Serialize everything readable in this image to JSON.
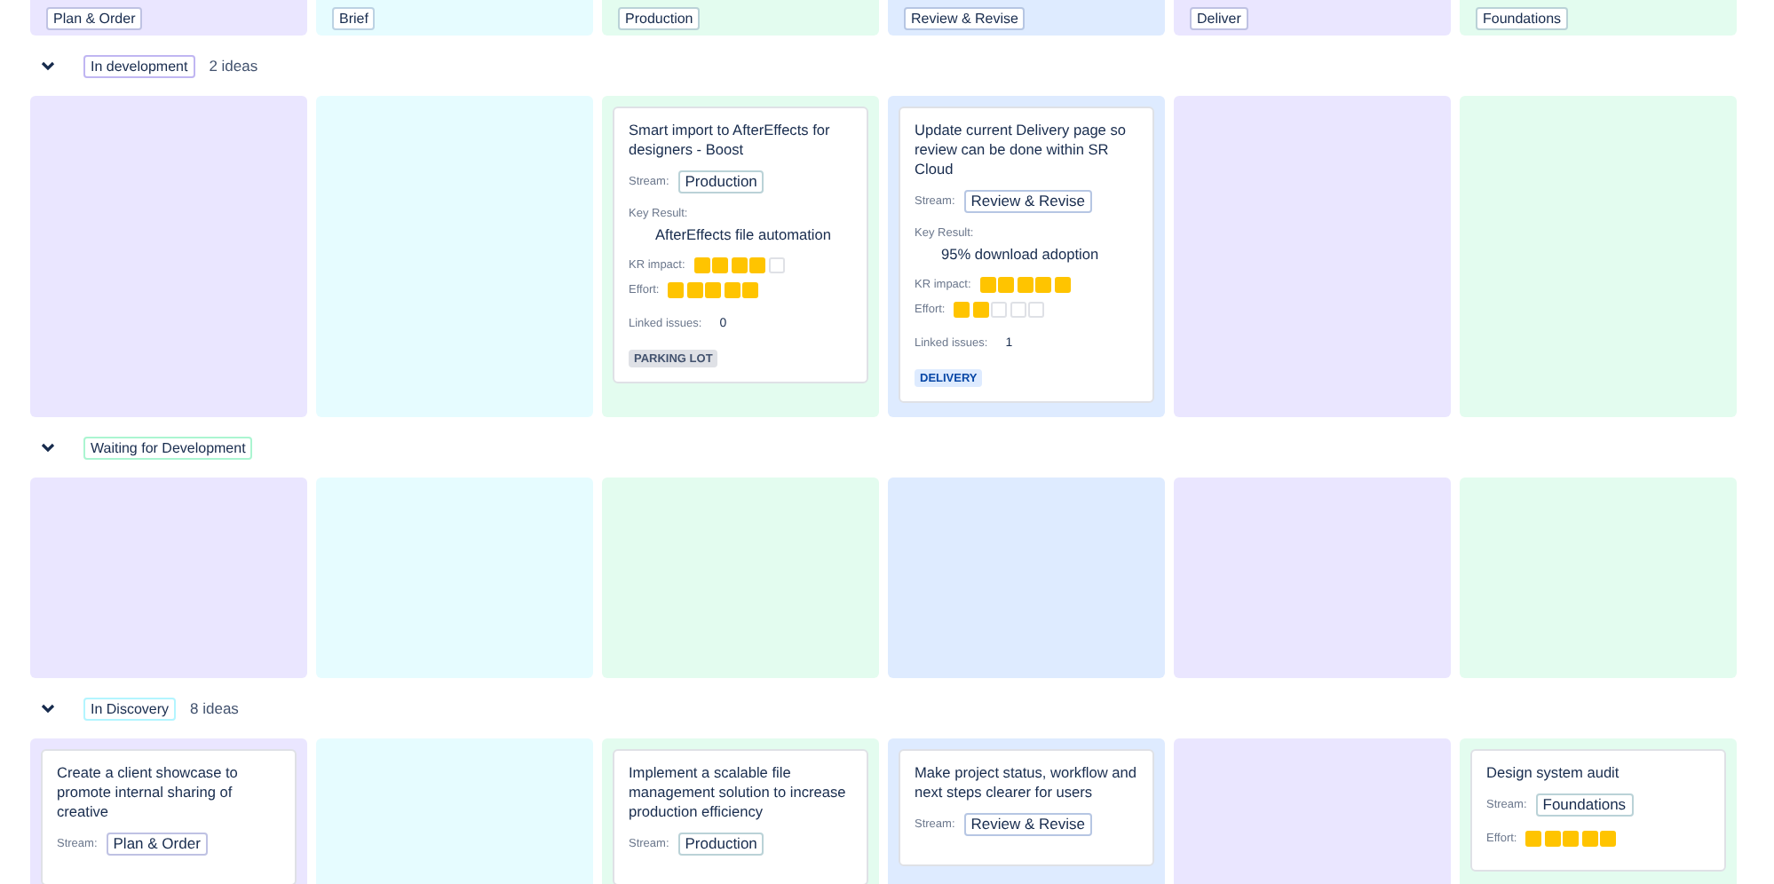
{
  "columns": [
    {
      "label": "Plan & Order",
      "color": "#eae6ff"
    },
    {
      "label": "Brief",
      "color": "#e6fcff"
    },
    {
      "label": "Production",
      "color": "#e3fcef"
    },
    {
      "label": "Review & Revise",
      "color": "#deebff"
    },
    {
      "label": "Deliver",
      "color": "#eae6ff"
    },
    {
      "label": "Foundations",
      "color": "#e3fcef"
    }
  ],
  "sections": [
    {
      "label": "In development",
      "count": "2 ideas",
      "expanded": true,
      "color": "#c0b6f2",
      "cells": [
        {},
        {},
        {
          "cards": [
            {
              "title": "Smart import to AfterEffects for designers - Boost",
              "stream_label": "Stream:",
              "stream": "Production",
              "key_result_label": "Key Result:",
              "key_result": "AfterEffects file automation",
              "ratings": [
                {
                  "label": "KR impact:",
                  "stars": 4
                },
                {
                  "label": "Effort:",
                  "stars": 5
                }
              ],
              "linked_label": "Linked issues:",
              "linked": "0",
              "badge": {
                "text": "PARKING LOT",
                "kind": "default"
              }
            }
          ]
        },
        {
          "cards": [
            {
              "title": "Update current Delivery page so review can be done within SR Cloud",
              "stream_label": "Stream:",
              "stream": "Review & Revise",
              "key_result_label": "Key Result:",
              "key_result": "95% download adoption",
              "ratings": [
                {
                  "label": "KR impact:",
                  "stars": 5
                },
                {
                  "label": "Effort:",
                  "stars": 2
                }
              ],
              "linked_label": "Linked issues:",
              "linked": "1",
              "badge": {
                "text": "DELIVERY",
                "kind": "info"
              }
            }
          ]
        },
        {},
        {}
      ]
    },
    {
      "label": "Waiting for Development",
      "expanded": true,
      "color": "#abf5d1",
      "cells": [
        {},
        {},
        {},
        {},
        {},
        {}
      ]
    },
    {
      "label": "In Discovery",
      "count": "8 ideas",
      "expanded": true,
      "color": "#b3f5ff",
      "cells": [
        {
          "cards": [
            {
              "title": "Create a client showcase to promote internal sharing of creative",
              "stream_label": "Stream:",
              "stream": "Plan & Order"
            }
          ]
        },
        {},
        {
          "cards": [
            {
              "title": "Implement a scalable file management solution to increase production efficiency",
              "stream_label": "Stream:",
              "stream": "Production"
            }
          ]
        },
        {
          "cards": [
            {
              "title": "Make project status, workflow and next steps clearer for users",
              "stream_label": "Stream:",
              "stream": "Review & Revise"
            }
          ]
        },
        {},
        {
          "cards": [
            {
              "title": "Design system audit",
              "stream_label": "Stream:",
              "stream": "Foundations",
              "ratings": [
                {
                  "label": "Effort:",
                  "stars": 5
                }
              ]
            }
          ]
        }
      ]
    }
  ]
}
